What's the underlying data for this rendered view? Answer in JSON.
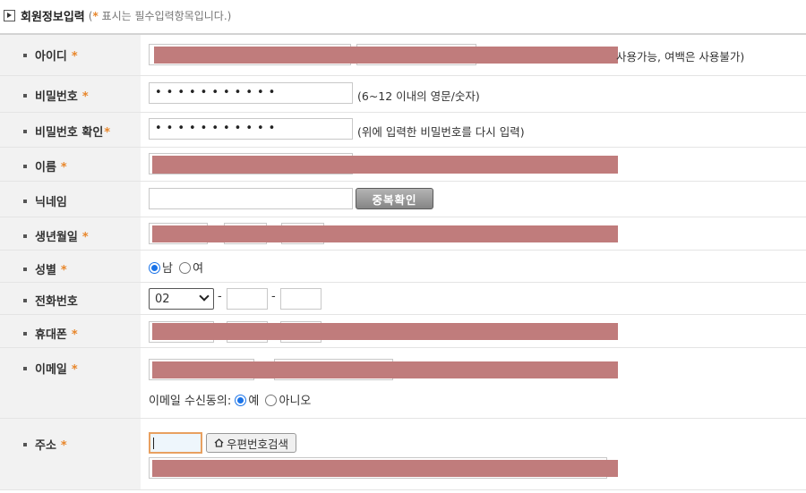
{
  "header": {
    "title": "회원정보입력",
    "note_open": "(",
    "note_star": "*",
    "note_text": " 표시는 필수입력항목입니다.)"
  },
  "fields": {
    "user_id": {
      "label": "아이디",
      "hint": "사용가능, 여백은 사용불가)"
    },
    "password": {
      "label": "비밀번호",
      "value": "•••••••••••",
      "hint": "(6~12 이내의 영문/숫자)"
    },
    "password_confirm": {
      "label": "비밀번호 확인",
      "value": "•••••••••••",
      "hint": "(위에 입력한 비밀번호를 다시 입력)"
    },
    "name": {
      "label": "이름"
    },
    "nickname": {
      "label": "닉네임",
      "button": "중복확인"
    },
    "birth": {
      "label": "생년월일"
    },
    "gender": {
      "label": "성별",
      "options": [
        "남",
        "여"
      ],
      "selected": "남"
    },
    "phone": {
      "label": "전화번호",
      "area_code": "02",
      "sep": "-"
    },
    "mobile": {
      "label": "휴대폰"
    },
    "email": {
      "label": "이메일",
      "consent_label": "이메일 수신동의:",
      "consent_options": [
        "예",
        "아니오"
      ],
      "consent_selected": "예"
    },
    "address": {
      "label": "주소",
      "zip_button": "우편번호검색"
    }
  },
  "required_mark": "*",
  "colors": {
    "required": "#e8862a",
    "label_bg": "#f2f2f2",
    "redaction": "#c07c7c",
    "radio_selected": "#1a73e8"
  },
  "icons": {
    "title": "play-box-icon",
    "zip": "home-icon"
  }
}
